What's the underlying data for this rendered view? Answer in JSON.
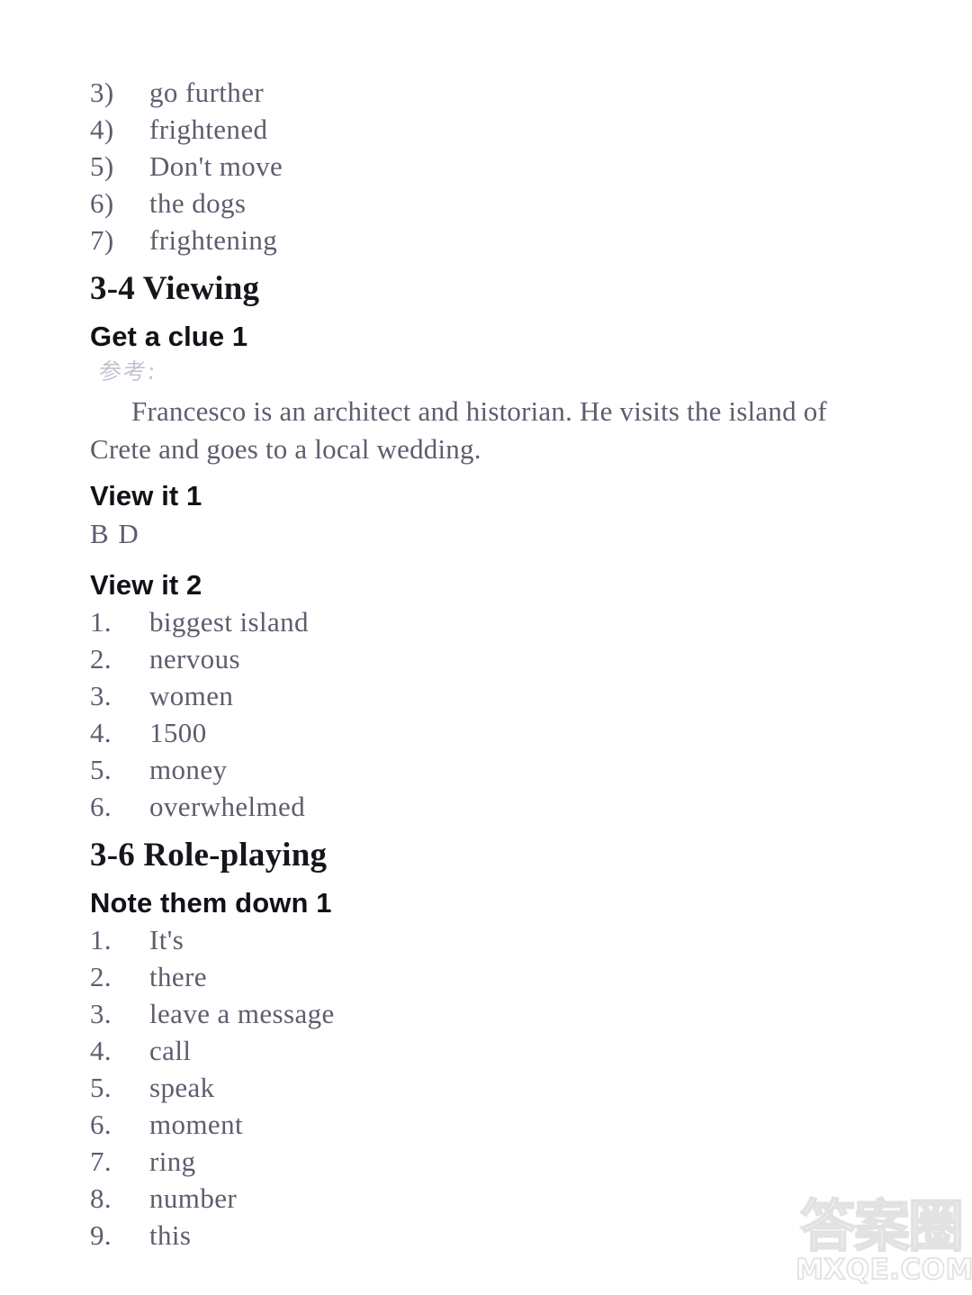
{
  "document": {
    "page_background": "#ffffff",
    "body_text_color": "#5c5e6e",
    "heading_color": "#16161c"
  },
  "top_list": {
    "items": [
      {
        "marker": "3)",
        "text": "go further"
      },
      {
        "marker": "4)",
        "text": "frightened"
      },
      {
        "marker": "5)",
        "text": "Don't move"
      },
      {
        "marker": "6)",
        "text": "the dogs"
      },
      {
        "marker": "7)",
        "text": "frightening"
      }
    ]
  },
  "section_viewing": {
    "heading": "3-4 Viewing",
    "get_a_clue": {
      "heading": "Get a clue 1",
      "annotation": "参考:",
      "paragraph": "Francesco is an architect and historian. He visits the island of Crete and goes to a local wedding."
    },
    "view_it_1": {
      "heading": "View it 1",
      "answer": "B D"
    },
    "view_it_2": {
      "heading": "View it 2",
      "items": [
        {
          "marker": "1.",
          "text": "biggest island"
        },
        {
          "marker": "2.",
          "text": "nervous"
        },
        {
          "marker": "3.",
          "text": "women"
        },
        {
          "marker": "4.",
          "text": "1500"
        },
        {
          "marker": "5.",
          "text": "money"
        },
        {
          "marker": "6.",
          "text": "overwhelmed"
        }
      ]
    }
  },
  "section_role_playing": {
    "heading": "3-6 Role-playing",
    "note_them_down": {
      "heading": "Note them down 1",
      "items": [
        {
          "marker": "1.",
          "text": "It's"
        },
        {
          "marker": "2.",
          "text": "there"
        },
        {
          "marker": "3.",
          "text": "leave a message"
        },
        {
          "marker": "4.",
          "text": "call"
        },
        {
          "marker": "5.",
          "text": "speak"
        },
        {
          "marker": "6.",
          "text": "moment"
        },
        {
          "marker": "7.",
          "text": "ring"
        },
        {
          "marker": "8.",
          "text": "number"
        },
        {
          "marker": "9.",
          "text": "this"
        }
      ]
    }
  },
  "watermark": {
    "cjk": "答案圈",
    "domain": "MXQE.COM",
    "color": "#e3e3e3"
  }
}
